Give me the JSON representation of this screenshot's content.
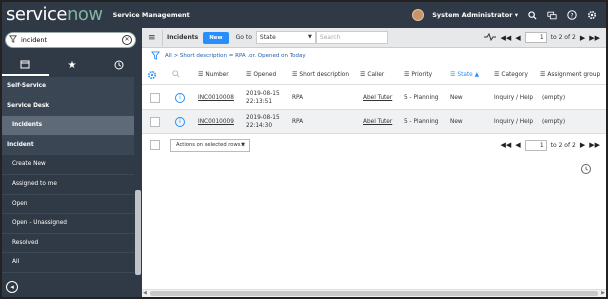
{
  "header": {
    "logo_service": "service",
    "logo_now": "now",
    "product": "Service Management",
    "user": "System Administrator",
    "user_caret": "▾",
    "icons": [
      "search-icon",
      "chat-icon",
      "help-icon",
      "gear-icon"
    ]
  },
  "sidebar": {
    "filter_value": "incident",
    "tabs": [
      "all-apps-icon",
      "favorites-icon",
      "history-icon"
    ],
    "items": [
      {
        "label": "Self-Service",
        "kind": "module"
      },
      {
        "label": "Service Desk",
        "kind": "module"
      },
      {
        "label": "Incidents",
        "kind": "selected"
      },
      {
        "label": "Incident",
        "kind": "module"
      },
      {
        "label": "Create New",
        "kind": "sub"
      },
      {
        "label": "Assigned to me",
        "kind": "sub"
      },
      {
        "label": "Open",
        "kind": "sub"
      },
      {
        "label": "Open - Unassigned",
        "kind": "sub"
      },
      {
        "label": "Resolved",
        "kind": "sub"
      },
      {
        "label": "All",
        "kind": "sub"
      }
    ]
  },
  "toolbar": {
    "title": "Incidents",
    "new_label": "New",
    "goto_label": "Go to",
    "goto_field": "State",
    "search_placeholder": "Search",
    "page_current": "1",
    "page_total": "to 2 of 2"
  },
  "breadcrumb": "All > Short description = RPA .or. Opened on Today",
  "columns": [
    "Number",
    "Opened",
    "Short description",
    "Caller",
    "Priority",
    "State",
    "Category",
    "Assignment group"
  ],
  "sorted_column": "State",
  "rows": [
    {
      "number": "INC0010008",
      "opened_date": "2019-08-15",
      "opened_time": "22:13:51",
      "short_description": "RPA",
      "caller": "Abel Tuter",
      "priority": "5 - Planning",
      "state": "New",
      "category": "Inquiry / Help",
      "assignment_group": "(empty)"
    },
    {
      "number": "INC0010009",
      "opened_date": "2019-08-15",
      "opened_time": "22:14:30",
      "short_description": "RPA",
      "caller": "Abel Tuter",
      "priority": "5 - Planning",
      "state": "New",
      "category": "Inquiry / Help",
      "assignment_group": "(empty)"
    }
  ],
  "actions_label": "Actions on selected rows...",
  "footer_page_current": "1",
  "footer_page_total": "to 2 of 2",
  "colors": {
    "header_bg": "#303a46",
    "accent": "#278efc",
    "logo_now": "#81b5a1"
  }
}
